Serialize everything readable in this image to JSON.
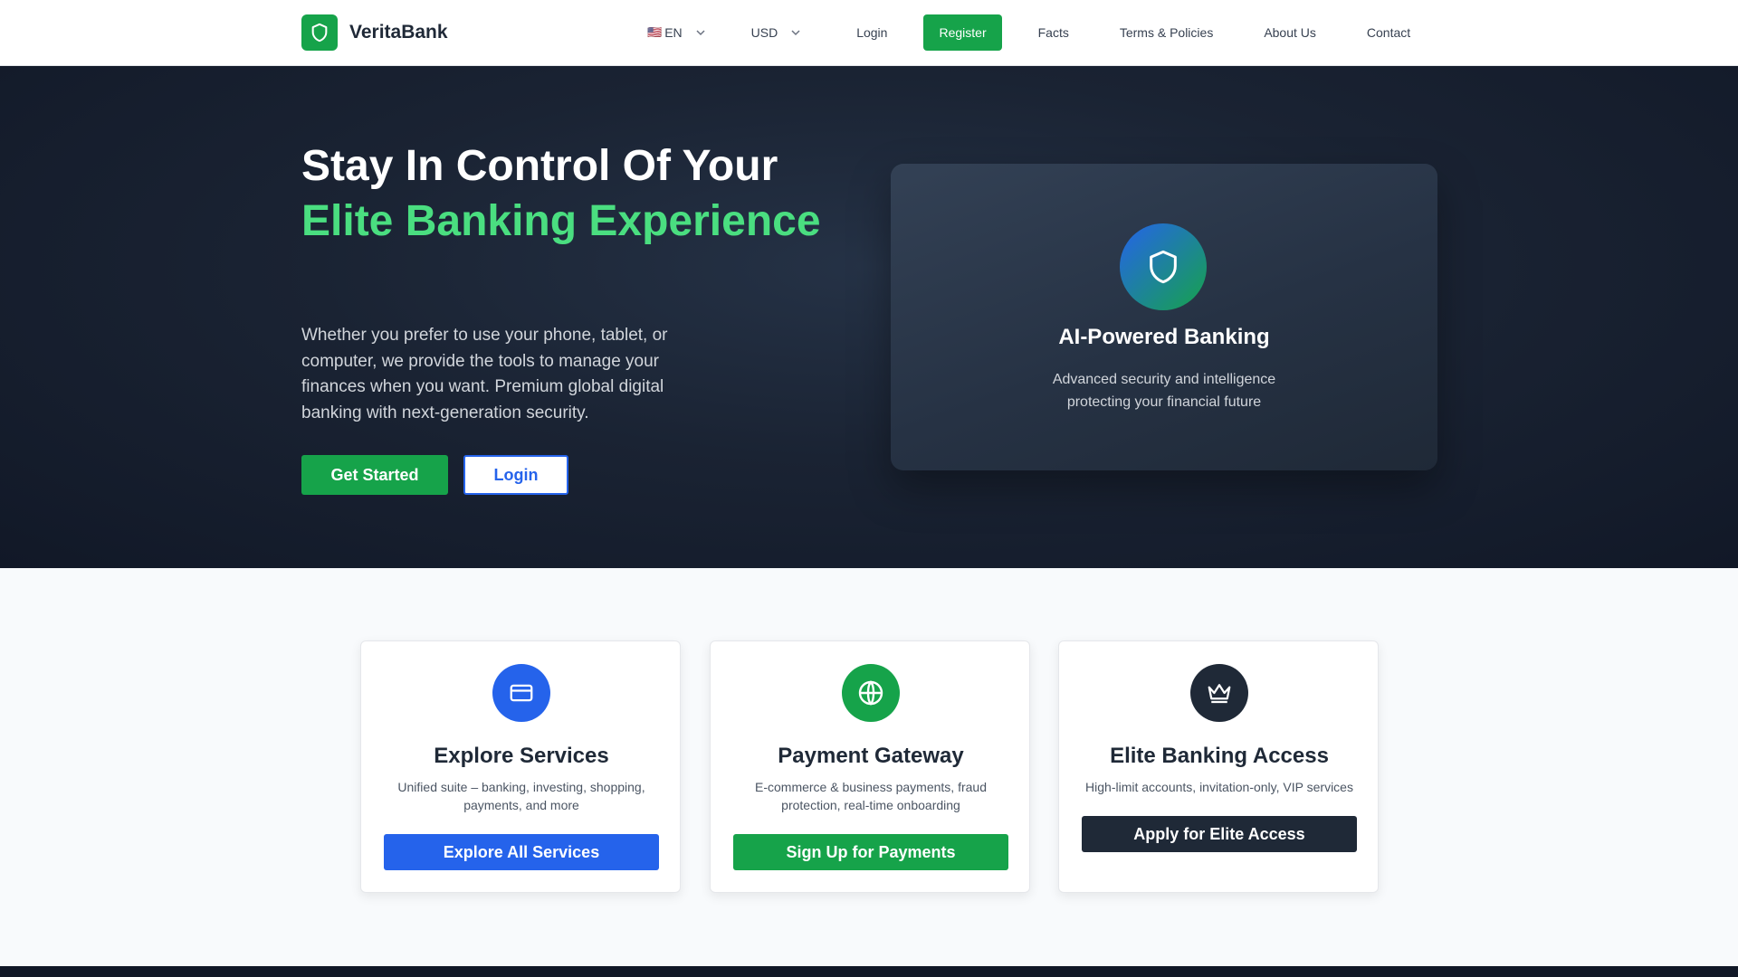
{
  "brand": {
    "name": "VeritaBank"
  },
  "nav": {
    "language": "EN",
    "language_flag": "🇺🇸",
    "currency": "USD",
    "login": "Login",
    "register": "Register",
    "facts": "Facts",
    "terms": "Terms & Policies",
    "about": "About Us",
    "contact": "Contact"
  },
  "hero": {
    "title_line1": "Stay In Control Of Your",
    "title_accent": "Elite Banking Experience",
    "description": "Whether you prefer to use your phone, tablet, or computer, we provide the tools to manage your finances when you want. Premium global digital banking with next-generation security.",
    "get_started": "Get Started",
    "login": "Login"
  },
  "ai_card": {
    "title": "AI-Powered Banking",
    "description": "Advanced security and intelligence protecting your financial future"
  },
  "cards": [
    {
      "title": "Explore Services",
      "description": "Unified suite – banking, investing, shopping, payments, and more",
      "button": "Explore All Services",
      "icon": "credit-card-icon",
      "color": "#2563eb"
    },
    {
      "title": "Payment Gateway",
      "description": "E-commerce & business payments, fraud protection, real-time onboarding",
      "button": "Sign Up for Payments",
      "icon": "globe-icon",
      "color": "#16a34a"
    },
    {
      "title": "Elite Banking Access",
      "description": "High-limit accounts, invitation-only, VIP services",
      "button": "Apply for Elite Access",
      "icon": "crown-icon",
      "color": "#1f2937"
    }
  ],
  "colors": {
    "primary_green": "#16a34a",
    "accent_green": "#4ade80",
    "primary_blue": "#2563eb",
    "dark": "#1f2937"
  }
}
